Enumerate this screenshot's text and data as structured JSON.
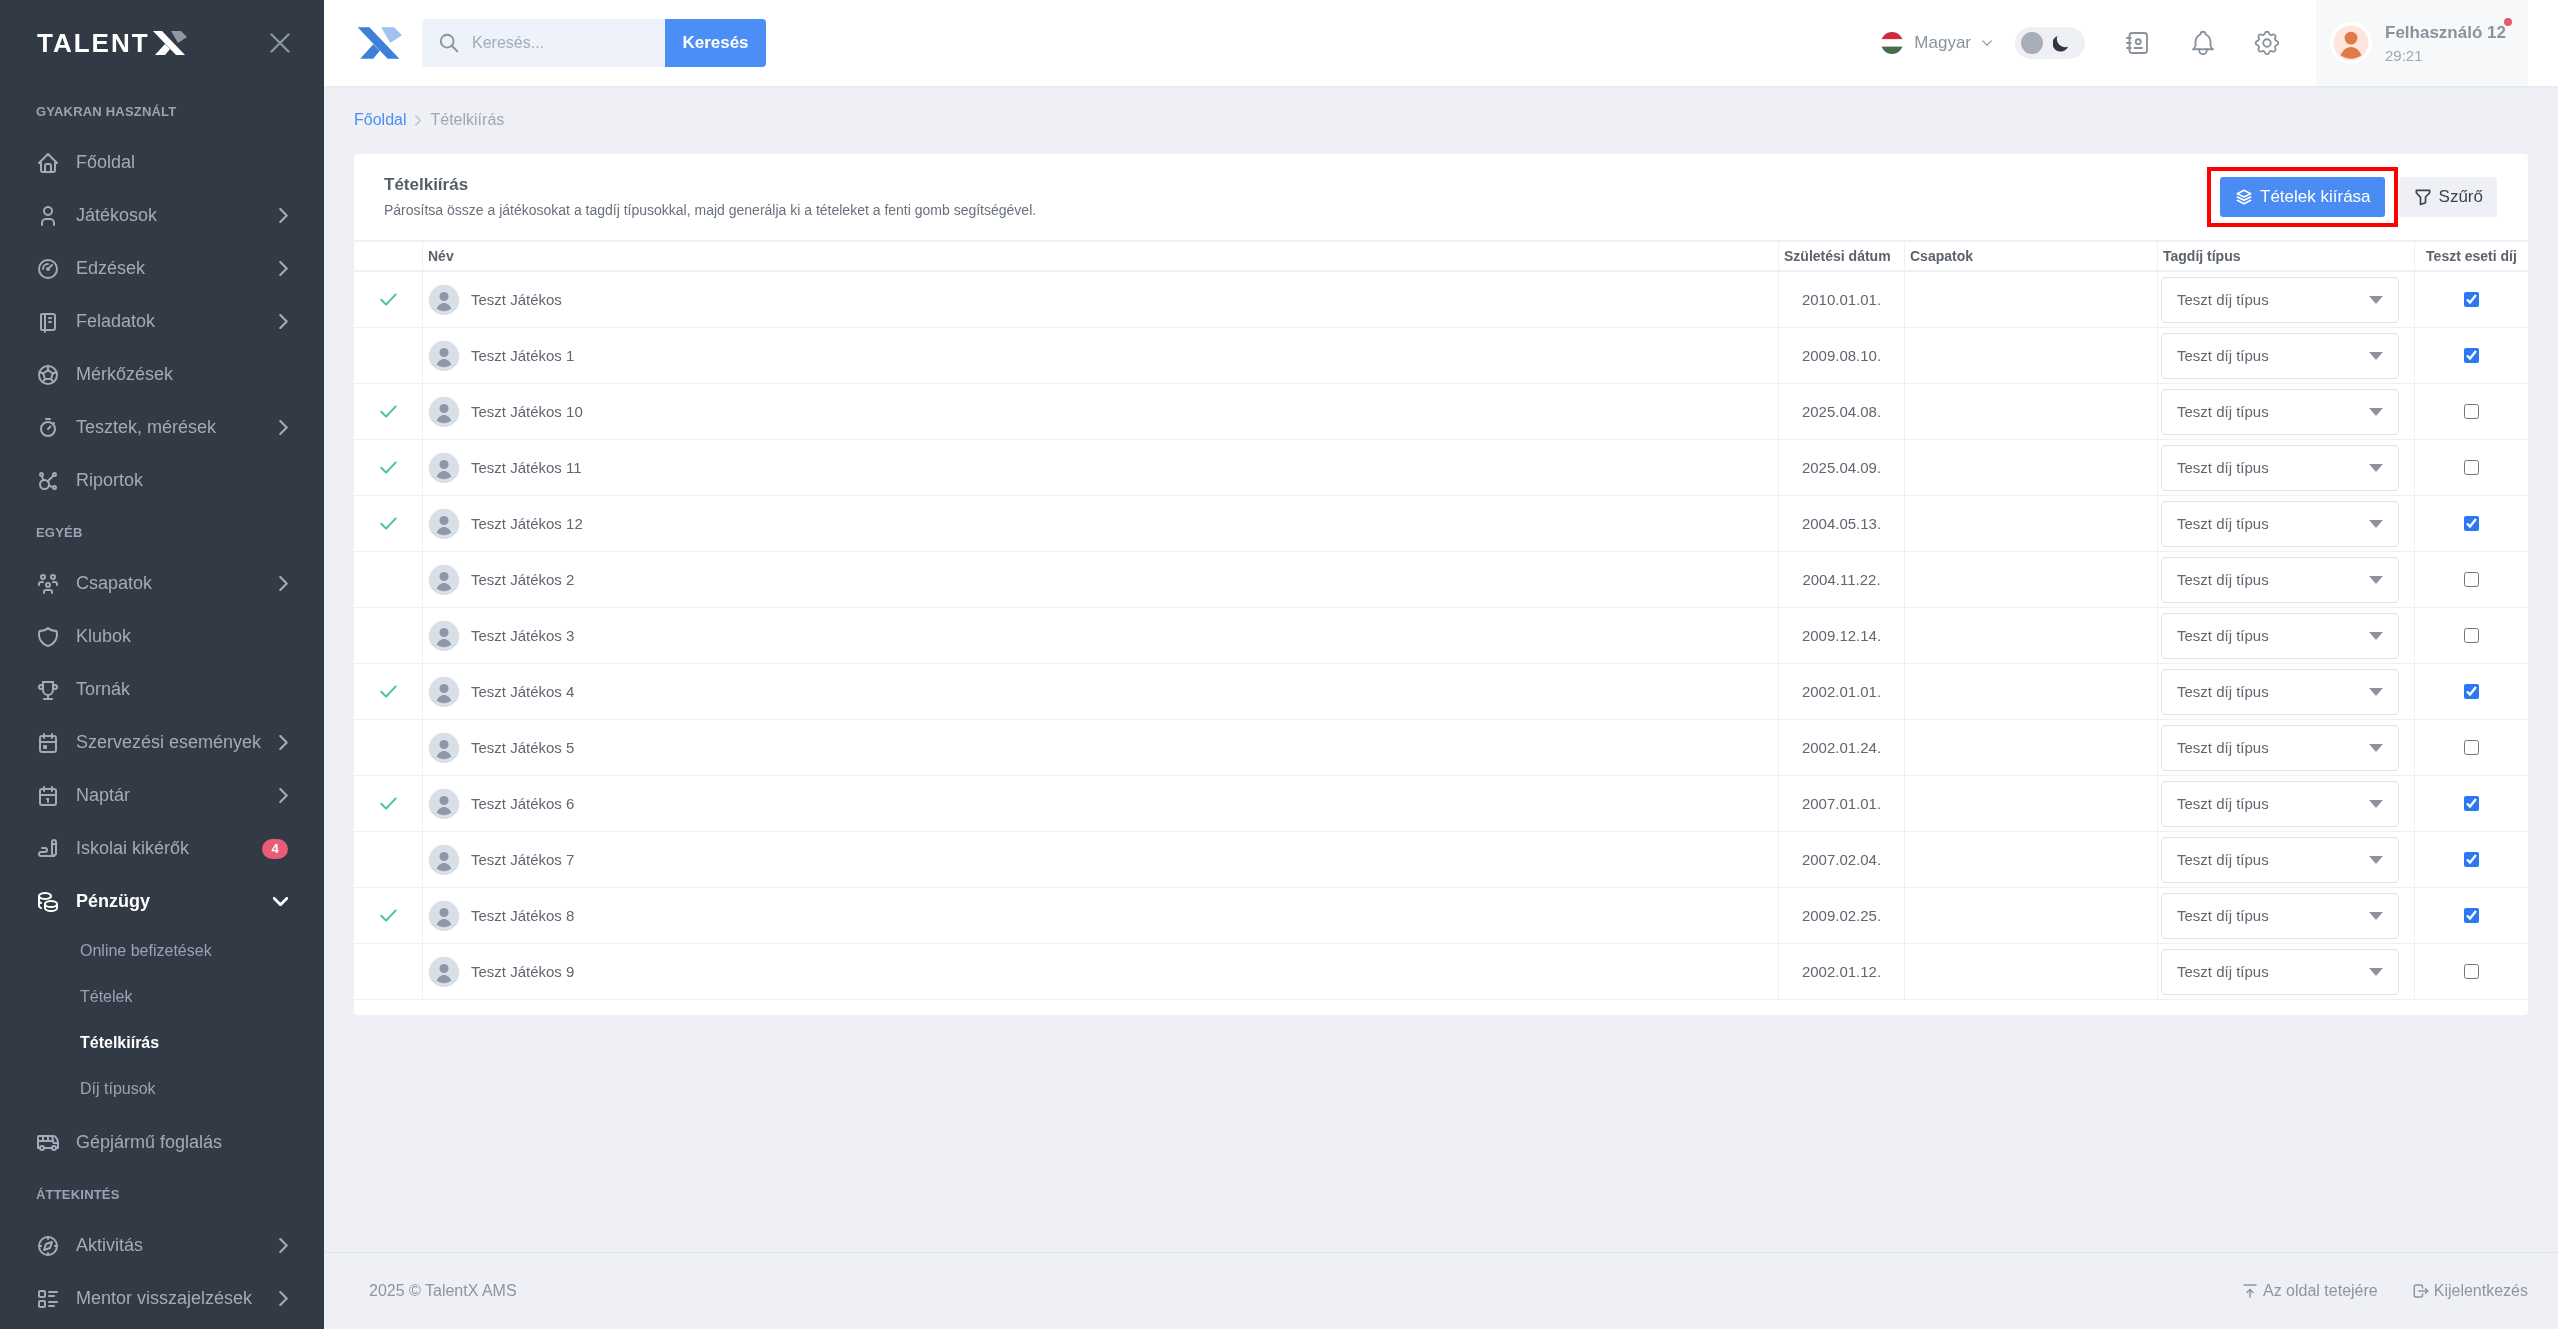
{
  "sidebar": {
    "logo": "TALENT",
    "sections": [
      {
        "heading": "GYAKRAN HASZNÁLT",
        "items": [
          {
            "label": "Főoldal",
            "kind": "link"
          },
          {
            "label": "Játékosok",
            "kind": "menu",
            "expanded": false
          },
          {
            "label": "Edzések",
            "kind": "menu",
            "expanded": false
          },
          {
            "label": "Feladatok",
            "kind": "menu",
            "expanded": false
          },
          {
            "label": "Mérkőzések",
            "kind": "link"
          },
          {
            "label": "Tesztek, mérések",
            "kind": "menu",
            "expanded": false
          },
          {
            "label": "Riportok",
            "kind": "link"
          }
        ]
      },
      {
        "heading": "EGYÉB",
        "items": [
          {
            "label": "Csapatok",
            "kind": "menu",
            "expanded": false
          },
          {
            "label": "Klubok",
            "kind": "link"
          },
          {
            "label": "Tornák",
            "kind": "link"
          },
          {
            "label": "Szervezési események",
            "kind": "menu",
            "expanded": false
          },
          {
            "label": "Naptár",
            "kind": "menu",
            "expanded": false
          },
          {
            "label": "Iskolai kikérők",
            "kind": "link",
            "badge": "4"
          },
          {
            "label": "Pénzügy",
            "kind": "menu",
            "expanded": true,
            "children": [
              {
                "label": "Online befizetések",
                "selected": false
              },
              {
                "label": "Tételek",
                "selected": false
              },
              {
                "label": "Tételkiírás",
                "selected": true
              },
              {
                "label": "Díj típusok",
                "selected": false
              }
            ]
          },
          {
            "label": "Gépjármű foglalás",
            "kind": "link"
          }
        ]
      },
      {
        "heading": "ÁTTEKINTÉS",
        "items": [
          {
            "label": "Aktivitás",
            "kind": "menu",
            "expanded": false
          },
          {
            "label": "Mentor visszajelzések",
            "kind": "menu",
            "expanded": false
          }
        ]
      }
    ]
  },
  "topbar": {
    "search": {
      "placeholder": "Keresés...",
      "button": "Keresés"
    },
    "language": "Magyar",
    "dark_mode": false,
    "user": {
      "name": "Felhasználó 12",
      "session_time": "29:21",
      "alert": true
    }
  },
  "breadcrumb": [
    {
      "label": "Főoldal",
      "current": false
    },
    {
      "label": "Tételkiírás",
      "current": true
    }
  ],
  "card": {
    "title": "Tételkiírás",
    "subtitle": "Párosítsa össze a játékosokat a tagdíj típusokkal, majd generálja ki a tételeket a fenti gomb segítségével.",
    "buttons": [
      {
        "label": "Tételek kiírása",
        "kind": "primary",
        "highlighted": true
      },
      {
        "label": "Szűrő",
        "kind": "secondary",
        "highlighted": false
      }
    ]
  },
  "table": {
    "columns": [
      "Név",
      "Születési dátum",
      "Csapatok",
      "Tagdíj típus",
      "Teszt eseti díj"
    ],
    "rows": [
      {
        "matched": true,
        "name": "Teszt Játékos",
        "birth_date": "2010.01.01.",
        "fee_type": "Teszt díj típus",
        "test_fee": true
      },
      {
        "matched": false,
        "name": "Teszt Játékos 1",
        "birth_date": "2009.08.10.",
        "fee_type": "Teszt díj típus",
        "test_fee": true
      },
      {
        "matched": true,
        "name": "Teszt Játékos 10",
        "birth_date": "2025.04.08.",
        "fee_type": "Teszt díj típus",
        "test_fee": false
      },
      {
        "matched": true,
        "name": "Teszt Játékos 11",
        "birth_date": "2025.04.09.",
        "fee_type": "Teszt díj típus",
        "test_fee": false
      },
      {
        "matched": true,
        "name": "Teszt Játékos 12",
        "birth_date": "2004.05.13.",
        "fee_type": "Teszt díj típus",
        "test_fee": true
      },
      {
        "matched": false,
        "name": "Teszt Játékos 2",
        "birth_date": "2004.11.22.",
        "fee_type": "Teszt díj típus",
        "test_fee": false
      },
      {
        "matched": false,
        "name": "Teszt Játékos 3",
        "birth_date": "2009.12.14.",
        "fee_type": "Teszt díj típus",
        "test_fee": false
      },
      {
        "matched": true,
        "name": "Teszt Játékos 4",
        "birth_date": "2002.01.01.",
        "fee_type": "Teszt díj típus",
        "test_fee": true
      },
      {
        "matched": false,
        "name": "Teszt Játékos 5",
        "birth_date": "2002.01.24.",
        "fee_type": "Teszt díj típus",
        "test_fee": false
      },
      {
        "matched": true,
        "name": "Teszt Játékos 6",
        "birth_date": "2007.01.01.",
        "fee_type": "Teszt díj típus",
        "test_fee": true
      },
      {
        "matched": false,
        "name": "Teszt Játékos 7",
        "birth_date": "2007.02.04.",
        "fee_type": "Teszt díj típus",
        "test_fee": true
      },
      {
        "matched": true,
        "name": "Teszt Játékos 8",
        "birth_date": "2009.02.25.",
        "fee_type": "Teszt díj típus",
        "test_fee": true
      },
      {
        "matched": false,
        "name": "Teszt Játékos 9",
        "birth_date": "2002.01.12.",
        "fee_type": "Teszt díj típus",
        "test_fee": false
      }
    ]
  },
  "footer": {
    "copyright": "2025 © TalentX AMS",
    "links": [
      "Az oldal tetejére",
      "Kijelentkezés"
    ]
  }
}
